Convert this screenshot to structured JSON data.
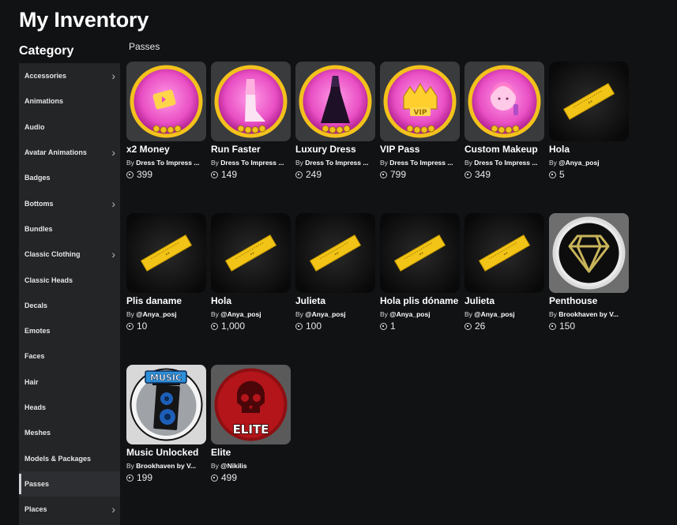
{
  "page": {
    "title": "My Inventory",
    "category_heading": "Category"
  },
  "sidebar": {
    "items": [
      {
        "label": "Accessories",
        "chevron": true
      },
      {
        "label": "Animations",
        "chevron": false
      },
      {
        "label": "Audio",
        "chevron": false
      },
      {
        "label": "Avatar Animations",
        "chevron": true
      },
      {
        "label": "Badges",
        "chevron": false
      },
      {
        "label": "Bottoms",
        "chevron": true
      },
      {
        "label": "Bundles",
        "chevron": false
      },
      {
        "label": "Classic Clothing",
        "chevron": true
      },
      {
        "label": "Classic Heads",
        "chevron": false
      },
      {
        "label": "Decals",
        "chevron": false
      },
      {
        "label": "Emotes",
        "chevron": false
      },
      {
        "label": "Faces",
        "chevron": false
      },
      {
        "label": "Hair",
        "chevron": false
      },
      {
        "label": "Heads",
        "chevron": false
      },
      {
        "label": "Meshes",
        "chevron": false
      },
      {
        "label": "Models & Packages",
        "chevron": false
      },
      {
        "label": "Passes",
        "chevron": false,
        "active": true
      },
      {
        "label": "Places",
        "chevron": true
      }
    ]
  },
  "main": {
    "section_label": "Passes",
    "items": [
      {
        "name": "x2 Money",
        "by": "By",
        "creator": "Dress To Impress ...",
        "price": "399",
        "icon": "money-gamepass-icon"
      },
      {
        "name": "Run Faster",
        "by": "By",
        "creator": "Dress To Impress ...",
        "price": "149",
        "icon": "run-faster-boot-icon"
      },
      {
        "name": "Luxury Dress",
        "by": "By",
        "creator": "Dress To Impress ...",
        "price": "249",
        "icon": "luxury-dress-icon"
      },
      {
        "name": "VIP Pass",
        "by": "By",
        "creator": "Dress To Impress ...",
        "price": "799",
        "icon": "vip-crown-icon"
      },
      {
        "name": "Custom Makeup",
        "by": "By",
        "creator": "Dress To Impress ...",
        "price": "349",
        "icon": "makeup-face-icon"
      },
      {
        "name": "Hola",
        "by": "By",
        "creator": "@Anya_posj",
        "price": "5",
        "icon": "gold-ticket-icon"
      },
      {
        "name": "Plis daname",
        "by": "By",
        "creator": "@Anya_posj",
        "price": "10",
        "icon": "gold-ticket-icon"
      },
      {
        "name": "Hola",
        "by": "By",
        "creator": "@Anya_posj",
        "price": "1,000",
        "icon": "gold-ticket-icon"
      },
      {
        "name": "Julieta",
        "by": "By",
        "creator": "@Anya_posj",
        "price": "100",
        "icon": "gold-ticket-icon"
      },
      {
        "name": "Hola plis dóname",
        "by": "By",
        "creator": "@Anya_posj",
        "price": "1",
        "icon": "gold-ticket-icon"
      },
      {
        "name": "Julieta",
        "by": "By",
        "creator": "@Anya_posj",
        "price": "26",
        "icon": "gold-ticket-icon"
      },
      {
        "name": "Penthouse",
        "by": "By",
        "creator": "Brookhaven by V...",
        "price": "150",
        "icon": "diamond-icon"
      },
      {
        "name": "Music Unlocked",
        "by": "By",
        "creator": "Brookhaven by V...",
        "price": "199",
        "icon": "music-speaker-icon",
        "thumb_text": "MUSIC"
      },
      {
        "name": "Elite",
        "by": "By",
        "creator": "@Nikilis",
        "price": "499",
        "icon": "skull-elite-icon",
        "thumb_text": "ELITE"
      }
    ]
  },
  "colors": {
    "background": "#111214",
    "sidebar": "#232527",
    "card": "#393b3d",
    "gold": "#f3c21c",
    "pink": "#e94fc4"
  }
}
